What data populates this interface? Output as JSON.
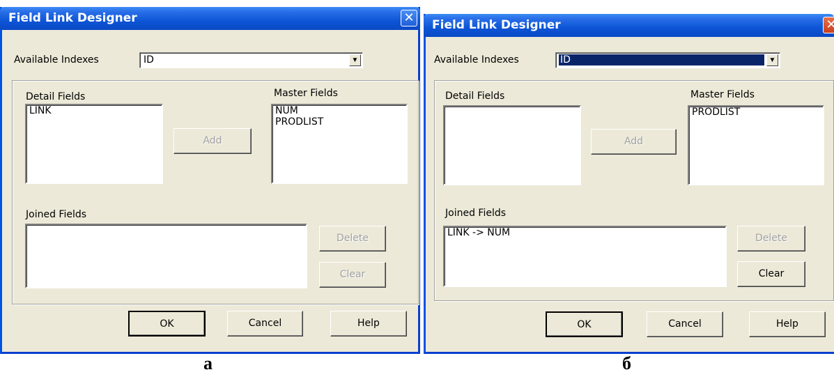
{
  "dialogs": [
    {
      "title": "Field Link Designer",
      "close": "✕",
      "available_indexes_label": "Available Indexes",
      "available_indexes_value": "ID",
      "detail_fields_label": "Detail Fields",
      "detail_fields": [
        "LINK"
      ],
      "master_fields_label": "Master Fields",
      "master_fields": [
        "NUM",
        "PRODLIST"
      ],
      "add": "Add",
      "joined_fields_label": "Joined Fields",
      "joined_fields": [],
      "delete": "Delete",
      "clear": "Clear",
      "ok": "OK",
      "cancel": "Cancel",
      "help": "Help",
      "caption": "а"
    },
    {
      "title": "Field Link Designer",
      "close": "✕",
      "available_indexes_label": "Available Indexes",
      "available_indexes_value": "ID",
      "detail_fields_label": "Detail Fields",
      "detail_fields": [],
      "master_fields_label": "Master Fields",
      "master_fields": [
        "PRODLIST"
      ],
      "add": "Add",
      "joined_fields_label": "Joined Fields",
      "joined_fields": [
        "LINK -> NUM"
      ],
      "delete": "Delete",
      "clear": "Clear",
      "ok": "OK",
      "cancel": "Cancel",
      "help": "Help",
      "caption": "б"
    }
  ]
}
